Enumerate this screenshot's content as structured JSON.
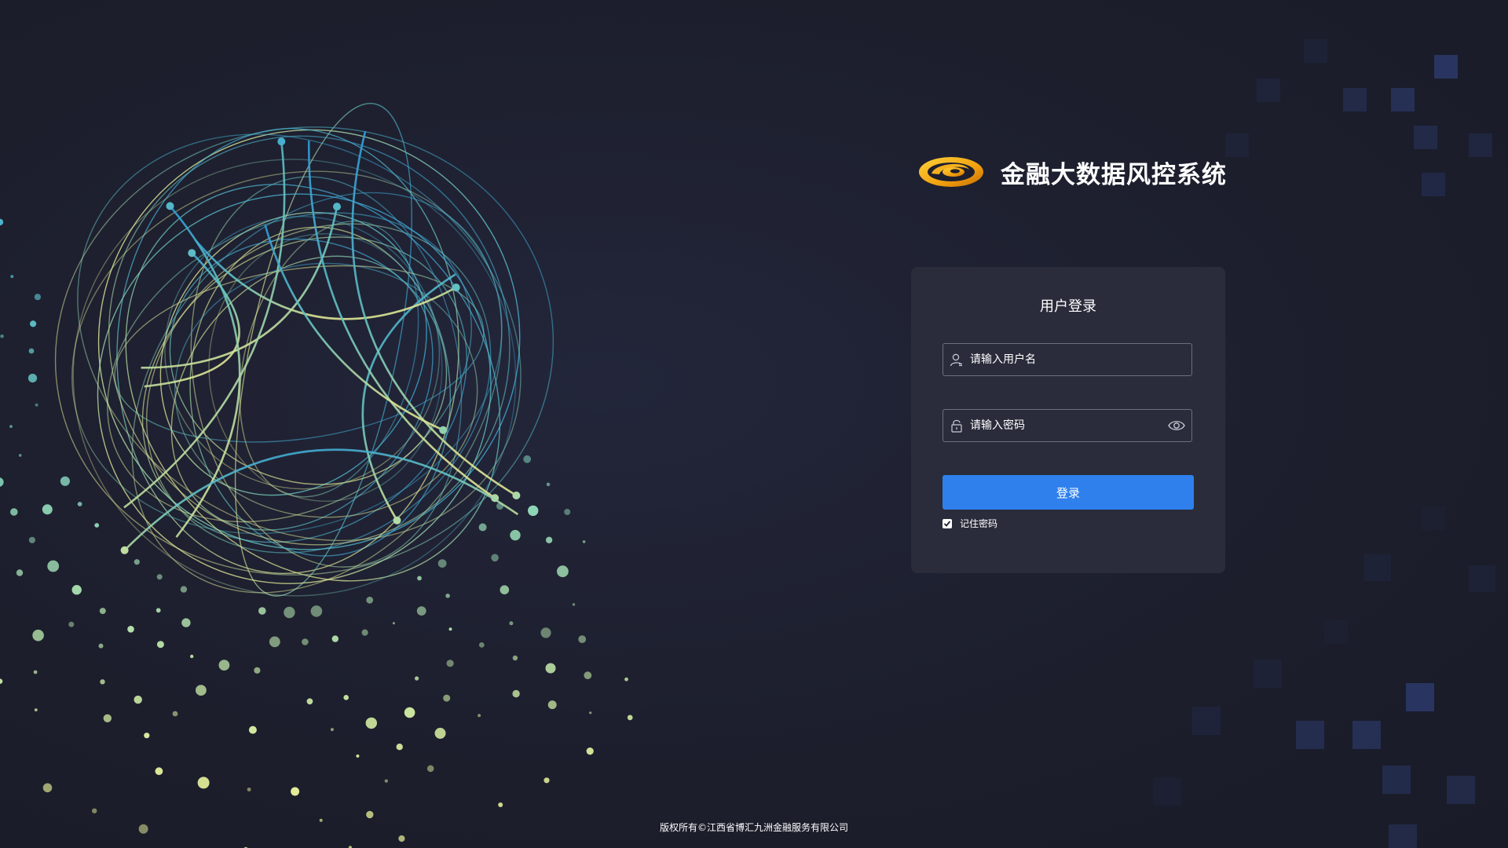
{
  "brand": {
    "title": "金融大数据风控系统",
    "logo_icon": "swirl-logo-icon"
  },
  "login": {
    "heading": "用户登录",
    "username": {
      "placeholder": "请输入用户名",
      "value": "",
      "icon": "user-icon"
    },
    "password": {
      "placeholder": "请输入密码",
      "value": "",
      "icon": "lock-icon",
      "toggle_icon": "eye-icon"
    },
    "submit_label": "登录",
    "remember": {
      "label": "记住密码",
      "checked": true
    }
  },
  "footer": {
    "copyright": "版权所有©江西省博汇九洲金融服务有限公司"
  },
  "colors": {
    "background": "#1d1f2e",
    "card": "#2a2c3b",
    "accent": "#2f80ed",
    "input_border": "#6b6f80",
    "decor_square": "#2b3866"
  }
}
